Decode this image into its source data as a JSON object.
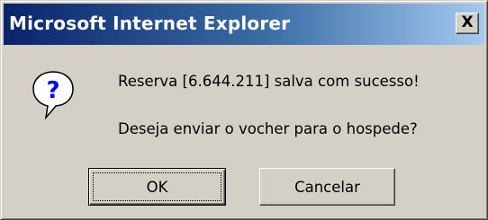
{
  "window": {
    "title": "Microsoft Internet Explorer",
    "close_label": "X"
  },
  "dialog": {
    "icon": "question-icon",
    "icon_glyph": "?",
    "message_line1": "Reserva [6.644.211] salva com sucesso!",
    "message_line2": "Deseja enviar o vocher para o hospede?"
  },
  "buttons": {
    "ok_label": "OK",
    "cancel_label": "Cancelar"
  },
  "colors": {
    "titlebar_start": "#0a246a",
    "titlebar_end": "#a6caf0",
    "dialog_bg": "#d4d0c8"
  }
}
